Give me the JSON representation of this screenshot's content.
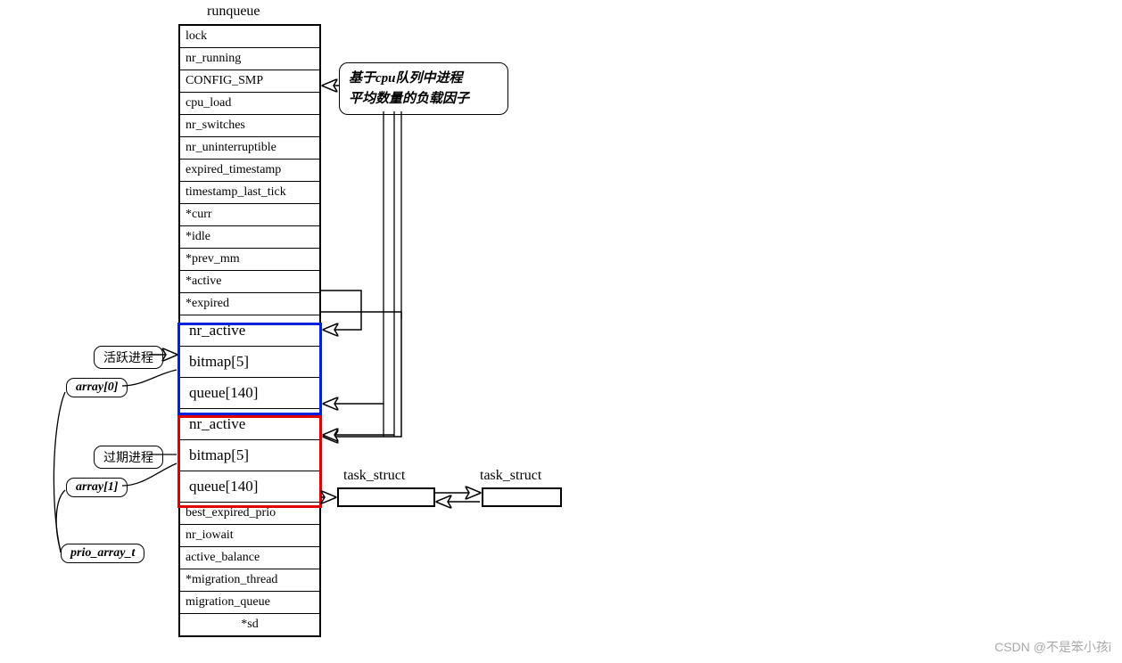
{
  "title": "runqueue",
  "rows": [
    "lock",
    "nr_running",
    "CONFIG_SMP",
    "cpu_load",
    "nr_switches",
    "nr_uninterruptible",
    "expired_timestamp",
    "timestamp_last_tick",
    "*curr",
    "*idle",
    "*prev_mm",
    "*active",
    "*expired"
  ],
  "array0": [
    "nr_active",
    "bitmap[5]",
    "queue[140]"
  ],
  "array1": [
    "nr_active",
    "bitmap[5]",
    "queue[140]"
  ],
  "rowsBottom": [
    "best_expired_prio",
    "nr_iowait",
    "active_balance",
    "*migration_thread",
    "migration_queue",
    "*sd"
  ],
  "callout": {
    "line1": "基于cpu队列中进程",
    "line2": "平均数量的负载因子"
  },
  "labels": {
    "activeProc": "活跃进程",
    "expiredProc": "过期进程",
    "array0": "array[0]",
    "array1": "array[1]",
    "prioArray": "prio_array_t",
    "taskStruct1": "task_struct",
    "taskStruct2": "task_struct"
  },
  "watermark": "CSDN @不是笨小孩i"
}
